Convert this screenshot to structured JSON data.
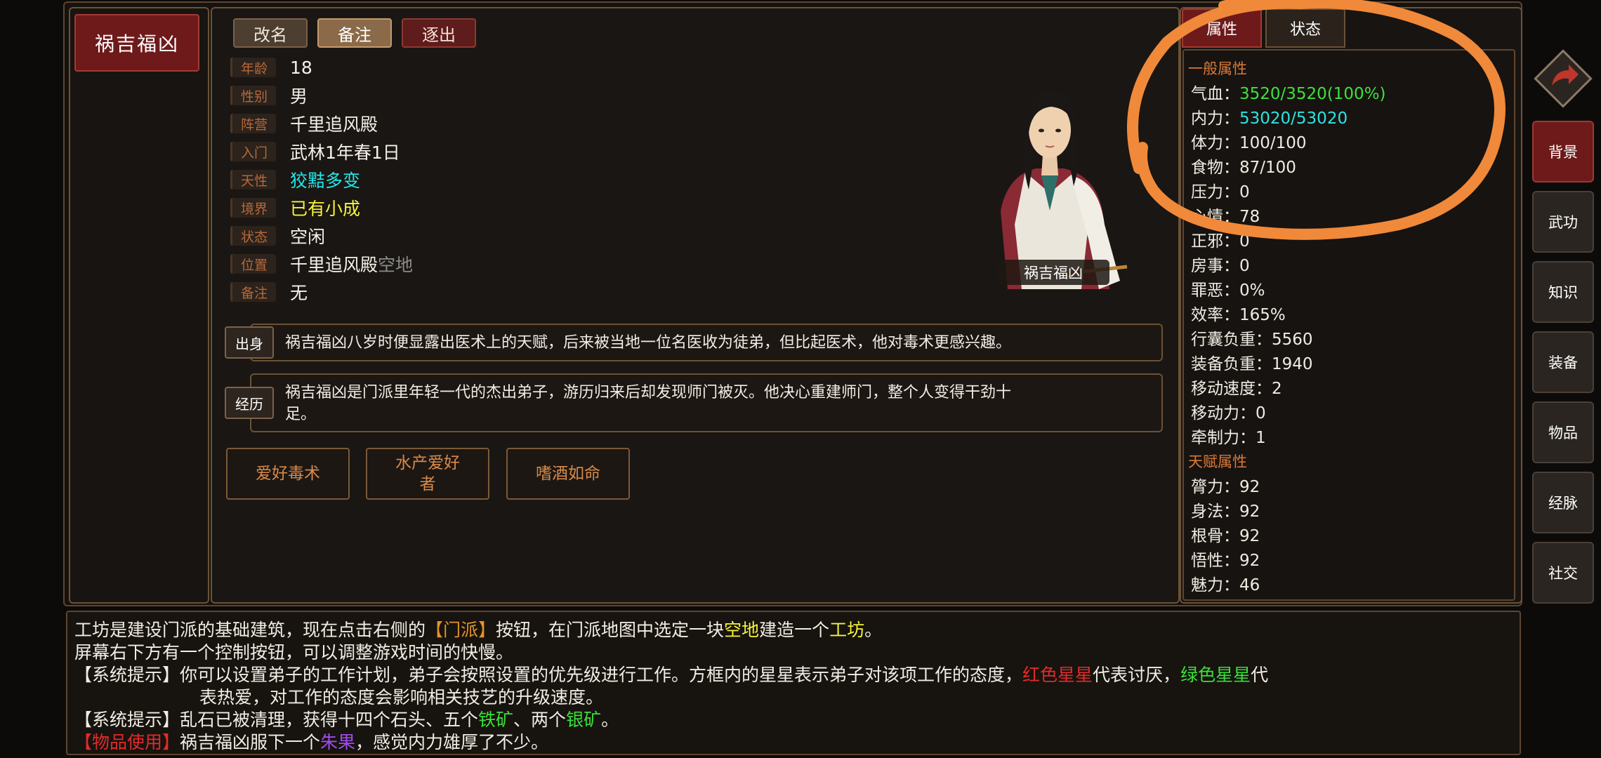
{
  "character": {
    "name": "祸吉福凶",
    "portrait_label": "祸吉福凶"
  },
  "actions": {
    "rename": "改名",
    "note": "备注",
    "expel": "逐出"
  },
  "info": [
    {
      "tag": "年龄",
      "value": "18"
    },
    {
      "tag": "性别",
      "value": "男"
    },
    {
      "tag": "阵营",
      "value": "千里追风殿"
    },
    {
      "tag": "入门",
      "value": "武林1年春1日"
    },
    {
      "tag": "天性",
      "value": "狡黠多变"
    },
    {
      "tag": "境界",
      "value": "已有小成"
    },
    {
      "tag": "状态",
      "value": "空闲"
    },
    {
      "tag": "位置",
      "value": "千里追风殿",
      "value_extra": "空地"
    },
    {
      "tag": "备注",
      "value": "无"
    }
  ],
  "background": {
    "origin_tag": "出身",
    "origin_text": "祸吉福凶八岁时便显露出医术上的天赋，后来被当地一位名医收为徒弟，但比起医术，他对毒术更感兴趣。",
    "history_tag": "经历",
    "history_line1": "祸吉福凶是门派里年轻一代的杰出弟子，游历归来后却发现师门被灭。他决心重建师门，整个人变得干劲十",
    "history_line2": "足。"
  },
  "traits": [
    {
      "line1": "爱好毒术",
      "line2": ""
    },
    {
      "line1": "水产爱好",
      "line2": "者"
    },
    {
      "line1": "嗜酒如命",
      "line2": ""
    }
  ],
  "right_tabs": {
    "attributes": "属性",
    "status": "状态"
  },
  "general_attributes": {
    "heading": "一般属性",
    "rows": [
      {
        "label": "气血：",
        "value": "3520/3520(100%)",
        "color": "#3ee03e"
      },
      {
        "label": "内力：",
        "value": "53020/53020",
        "color": "#2ee3e3"
      },
      {
        "label": "体力：",
        "value": "100/100"
      },
      {
        "label": "食物：",
        "value": "87/100"
      },
      {
        "label": "压力：",
        "value": "0"
      },
      {
        "label": "心情：",
        "value": "78"
      },
      {
        "label": "正邪：",
        "value": "0"
      },
      {
        "label": "房事：",
        "value": "0"
      },
      {
        "label": "罪恶：",
        "value": "0%"
      },
      {
        "label": "效率：",
        "value": "165%"
      },
      {
        "label": "行囊负重：",
        "value": "5560"
      },
      {
        "label": "装备负重：",
        "value": "1940"
      },
      {
        "label": "移动速度：",
        "value": "2"
      },
      {
        "label": "移动力：",
        "value": "0"
      },
      {
        "label": "牵制力：",
        "value": "1"
      }
    ]
  },
  "talent_attributes": {
    "heading": "天赋属性",
    "rows": [
      {
        "label": "膂力：",
        "value": "92"
      },
      {
        "label": "身法：",
        "value": "92"
      },
      {
        "label": "根骨：",
        "value": "92"
      },
      {
        "label": "悟性：",
        "value": "92"
      },
      {
        "label": "魅力：",
        "value": "46"
      }
    ]
  },
  "side_nav": [
    "背景",
    "武功",
    "知识",
    "装备",
    "物品",
    "经脉",
    "社交"
  ],
  "log": {
    "l1_a": "工坊是建设门派的基础建筑，现在点击右侧的",
    "l1_b": "【门派】",
    "l1_c": "按钮，在门派地图中选定一块",
    "l1_d": "空地",
    "l1_e": "建造一个",
    "l1_f": "工坊",
    "l1_g": "。",
    "l2": "屏幕右下方有一个控制按钮，可以调整游戏时间的快慢。",
    "l3_prefix": "【系统提示】",
    "l3_a": "你可以设置弟子的工作计划，弟子会按照设置的优先级进行工作。方框内的星星表示弟子对该项工作的态度，",
    "l3_b": "红色星星",
    "l3_c": "代表讨厌，",
    "l3_d": "绿色星星",
    "l3_e": "代",
    "l4": "表热爱，对工作的态度会影响相关技艺的升级速度。",
    "l5_prefix": "【系统提示】",
    "l5_a": "乱石已被清理，获得十四个石头、五个",
    "l5_b": "铁矿",
    "l5_c": "、两个",
    "l5_d": "银矿",
    "l5_e": "。",
    "l6_prefix": "【物品使用】",
    "l6_a": "祸吉福凶服下一个",
    "l6_b": "朱果",
    "l6_c": "，感觉内力雄厚了不少。"
  },
  "colors": {
    "accent_red": "#6e1a1a",
    "border_gold": "#6b5236",
    "annotation_orange": "#f0893a"
  }
}
